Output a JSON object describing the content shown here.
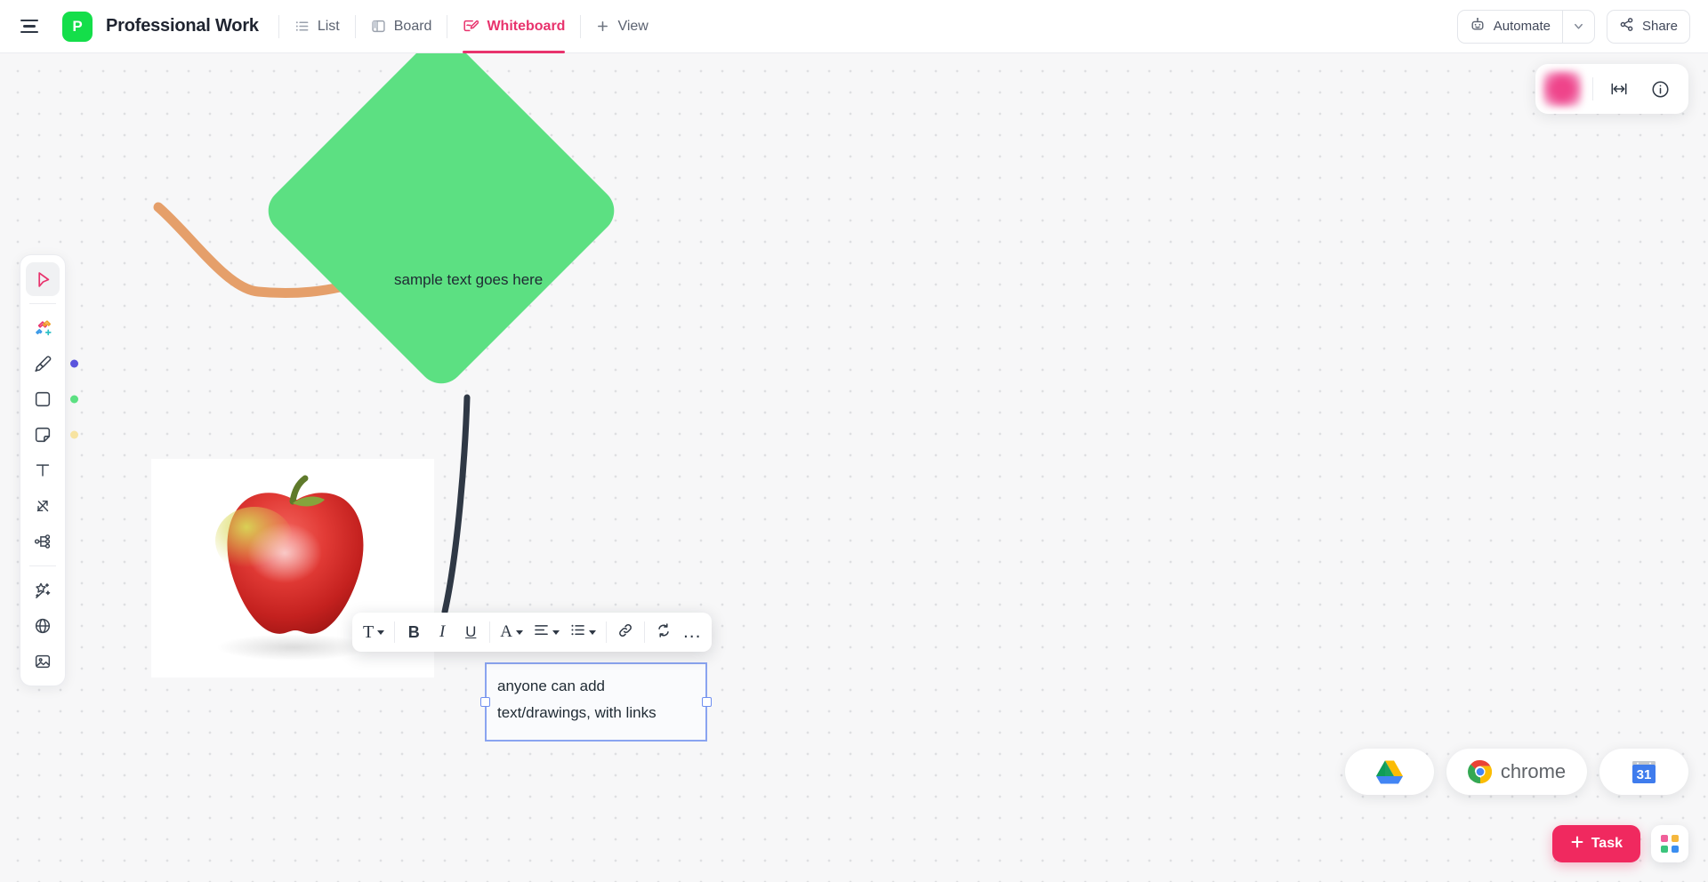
{
  "header": {
    "menu_icon": "hamburger-icon",
    "workspace_initial": "P",
    "project_title": "Professional Work",
    "tabs": [
      {
        "label": "List",
        "icon": "list-icon",
        "active": false
      },
      {
        "label": "Board",
        "icon": "board-icon",
        "active": false
      },
      {
        "label": "Whiteboard",
        "icon": "whiteboard-icon",
        "active": true
      }
    ],
    "add_view_label": "View",
    "automate_label": "Automate",
    "share_label": "Share",
    "accent_color": "#e8336d",
    "logo_color": "#14de4a"
  },
  "float_toolbar": {
    "avatar": "collaborator-avatar",
    "fit_label": "fit-to-screen-icon",
    "info_label": "info-icon"
  },
  "tool_rail": {
    "tools": [
      {
        "name": "select",
        "icon": "cursor-icon",
        "selected": true,
        "dot": ""
      },
      {
        "name": "shapes-add",
        "icon": "shapes-add-icon",
        "selected": false,
        "dot": ""
      },
      {
        "name": "marker",
        "icon": "marker-pen-icon",
        "selected": false,
        "dot": "#5b54dd"
      },
      {
        "name": "rectangle",
        "icon": "square-icon",
        "selected": false,
        "dot": "#5ce082"
      },
      {
        "name": "sticky-note",
        "icon": "sticky-note-icon",
        "selected": false,
        "dot": "#f7e3a1"
      },
      {
        "name": "text",
        "icon": "text-t-icon",
        "selected": false,
        "dot": ""
      },
      {
        "name": "connector",
        "icon": "connector-arrows-icon",
        "selected": false,
        "dot": ""
      },
      {
        "name": "mindmap",
        "icon": "mindmap-node-icon",
        "selected": false,
        "dot": ""
      },
      {
        "name": "ai-magic",
        "icon": "magic-wand-icon",
        "selected": false,
        "dot": ""
      },
      {
        "name": "embed",
        "icon": "globe-icon",
        "selected": false,
        "dot": ""
      },
      {
        "name": "image",
        "icon": "image-icon",
        "selected": false,
        "dot": ""
      }
    ]
  },
  "canvas": {
    "background": "#f7f7f8",
    "diamond": {
      "text": "sample text goes here",
      "fill": "#5ce082"
    },
    "orange_connector_color": "#e59f6a",
    "dark_connector_color": "#2f3845",
    "image_card": {
      "alt": "red-apple-photo"
    },
    "textbox": {
      "text": "anyone can add text/drawings, with links",
      "selected": true,
      "selection_color": "#8aa4f0"
    }
  },
  "format_toolbar": {
    "items": [
      {
        "name": "text-style",
        "label": "T",
        "caret": true
      },
      {
        "name": "bold",
        "label": "B",
        "caret": false
      },
      {
        "name": "italic",
        "label": "I",
        "caret": false
      },
      {
        "name": "underline",
        "label": "U",
        "caret": false
      },
      {
        "name": "text-color",
        "label": "A",
        "caret": true
      },
      {
        "name": "align",
        "label": "align-icon",
        "caret": true
      },
      {
        "name": "list",
        "label": "list-icon",
        "caret": true
      },
      {
        "name": "link",
        "label": "link-icon",
        "caret": false
      },
      {
        "name": "convert",
        "label": "convert-icon",
        "caret": false
      },
      {
        "name": "more",
        "label": "...",
        "caret": false
      }
    ]
  },
  "dock": {
    "apps": [
      {
        "name": "google-drive",
        "label": ""
      },
      {
        "name": "chrome",
        "label": "chrome"
      },
      {
        "name": "google-calendar",
        "label": "31"
      }
    ],
    "task_button_label": "Task",
    "apps_grid_label": "apps-grid-icon",
    "task_button_color": "#f0295f"
  }
}
